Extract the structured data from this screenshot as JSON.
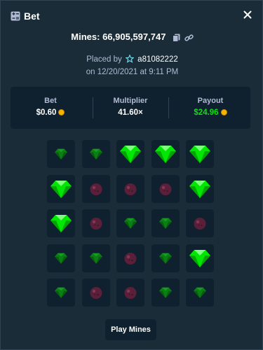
{
  "header": {
    "title": "Bet",
    "icon": "bet-icon",
    "close_icon": "close-icon"
  },
  "summary": {
    "mines_text": "Mines: 66,905,597,747",
    "copy_icon": "copy-icon",
    "link_icon": "link-icon",
    "placed_prefix": "Placed by",
    "user_icon": "vip-star-icon",
    "username": "a81082222",
    "date_text": "on 12/20/2021 at 9:11 PM"
  },
  "stats": {
    "bet_label": "Bet",
    "bet_value": "$0.60",
    "multiplier_label": "Multiplier",
    "multiplier_value": "41.60×",
    "payout_label": "Payout",
    "payout_value": "$24.96",
    "currency_icon": "coin-icon",
    "payout_color": "#00e701"
  },
  "board": {
    "legend": {
      "G": "gem-revealed",
      "g": "gem-dim",
      "m": "mine-dim"
    },
    "rows": [
      [
        "g",
        "g",
        "G",
        "G",
        "G"
      ],
      [
        "G",
        "m",
        "m",
        "m",
        "G"
      ],
      [
        "G",
        "m",
        "g",
        "g",
        "m"
      ],
      [
        "g",
        "g",
        "m",
        "g",
        "G"
      ],
      [
        "g",
        "m",
        "m",
        "g",
        "g"
      ]
    ]
  },
  "colors": {
    "background": "#1a2c38",
    "panel": "#0f212e",
    "gem_bright": "#00e701",
    "gem_dim": "#0b7f14",
    "mine_dim": "#5c1f3a"
  },
  "actions": {
    "play_label": "Play Mines"
  }
}
